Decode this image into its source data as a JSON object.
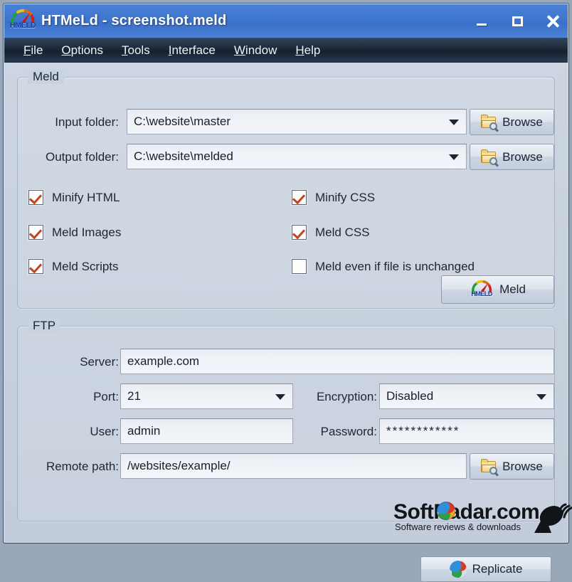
{
  "window": {
    "title": "HTMeLd - screenshot.meld",
    "logo_text": "HMELD",
    "minimize_label": "Minimize",
    "maximize_label": "Maximize",
    "close_label": "Close"
  },
  "menubar": {
    "items": [
      {
        "label": "File",
        "mnemonic": "F"
      },
      {
        "label": "Options",
        "mnemonic": "O"
      },
      {
        "label": "Tools",
        "mnemonic": "T"
      },
      {
        "label": "Interface",
        "mnemonic": "I"
      },
      {
        "label": "Window",
        "mnemonic": "W"
      },
      {
        "label": "Help",
        "mnemonic": "H"
      }
    ]
  },
  "meld_group": {
    "title": "Meld",
    "input_folder": {
      "label": "Input folder:",
      "value": "C:\\website\\master",
      "browse_label": "Browse"
    },
    "output_folder": {
      "label": "Output folder:",
      "value": "C:\\website\\melded",
      "browse_label": "Browse"
    },
    "checkboxes": [
      {
        "label": "Minify HTML",
        "checked": true
      },
      {
        "label": "Minify CSS",
        "checked": true
      },
      {
        "label": "Meld Images",
        "checked": true
      },
      {
        "label": "Meld CSS",
        "checked": true
      },
      {
        "label": "Meld Scripts",
        "checked": true
      },
      {
        "label": "Meld even if file is unchanged",
        "checked": false
      }
    ],
    "meld_button_label": "Meld"
  },
  "ftp_group": {
    "title": "FTP",
    "server": {
      "label": "Server:",
      "value": "example.com"
    },
    "port": {
      "label": "Port:",
      "value": "21"
    },
    "encryption": {
      "label": "Encryption:",
      "value": "Disabled"
    },
    "user": {
      "label": "User:",
      "value": "admin"
    },
    "password": {
      "label": "Password:",
      "value": "************"
    },
    "remote_path": {
      "label": "Remote path:",
      "value": "/websites/example/",
      "browse_label": "Browse"
    },
    "replicate_button_label": "Replicate"
  },
  "watermark": {
    "main": "SoftRadar.com",
    "sub": "Software reviews & downloads"
  },
  "colors": {
    "titlebar_blue": "#3f76ce",
    "menubar_dark": "#1c2838",
    "window_bg": "#c8d1de",
    "check_orange": "#c0441c",
    "field_bg": "#eef1f6"
  }
}
